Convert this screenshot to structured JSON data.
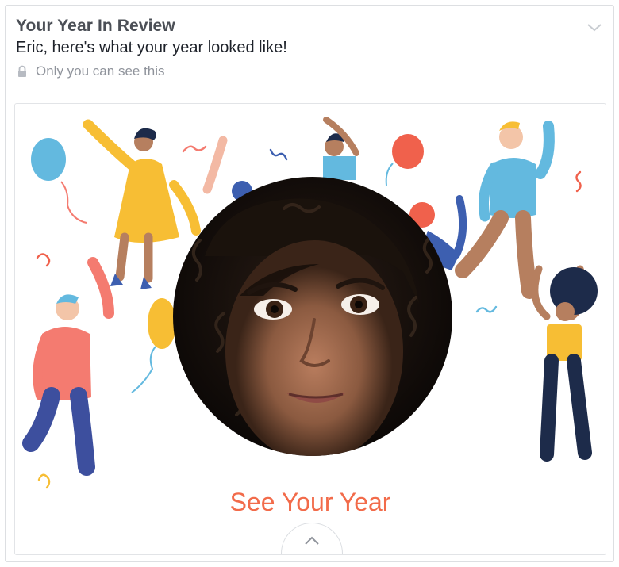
{
  "post": {
    "title": "Your Year In Review",
    "subtitle": "Eric, here's what your year looked like!",
    "privacy": "Only you can see this"
  },
  "media": {
    "cta": "See Your Year"
  },
  "icons": {
    "lock": "lock-icon",
    "menu": "chevron-down-icon",
    "expand": "chevron-up-icon"
  },
  "colors": {
    "cta": "#f26b4a",
    "title": "#4b4f56",
    "muted": "#90949c"
  }
}
